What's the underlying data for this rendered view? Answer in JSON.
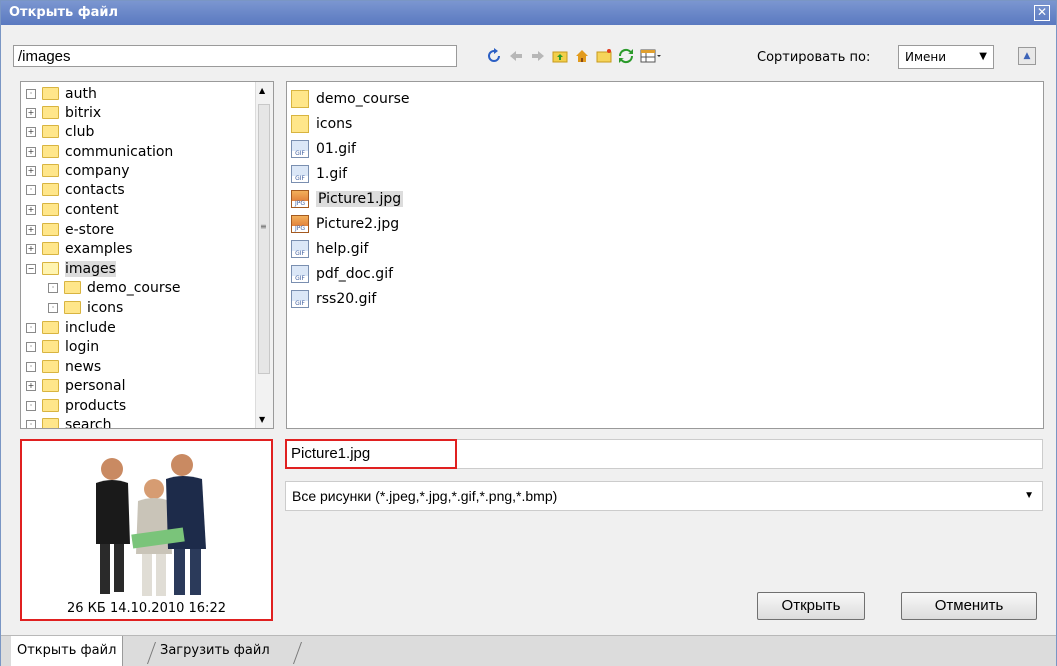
{
  "window": {
    "title": "Открыть файл"
  },
  "path": {
    "value": "/images"
  },
  "sort": {
    "label": "Сортировать по:",
    "value": "Имени"
  },
  "tree": {
    "items": [
      {
        "label": "auth",
        "exp": "·"
      },
      {
        "label": "bitrix",
        "exp": "+"
      },
      {
        "label": "club",
        "exp": "+"
      },
      {
        "label": "communication",
        "exp": "+"
      },
      {
        "label": "company",
        "exp": "+"
      },
      {
        "label": "contacts",
        "exp": "·"
      },
      {
        "label": "content",
        "exp": "+"
      },
      {
        "label": "e-store",
        "exp": "+"
      },
      {
        "label": "examples",
        "exp": "+"
      },
      {
        "label": "images",
        "exp": "−"
      },
      {
        "label": "demo_course",
        "exp": "·"
      },
      {
        "label": "icons",
        "exp": "·"
      },
      {
        "label": "include",
        "exp": "·"
      },
      {
        "label": "login",
        "exp": "·"
      },
      {
        "label": "news",
        "exp": "·"
      },
      {
        "label": "personal",
        "exp": "+"
      },
      {
        "label": "products",
        "exp": "·"
      },
      {
        "label": "search",
        "exp": "·"
      }
    ]
  },
  "files": [
    {
      "name": "demo_course"
    },
    {
      "name": "icons"
    },
    {
      "name": "01.gif"
    },
    {
      "name": "1.gif"
    },
    {
      "name": "Picture1.jpg"
    },
    {
      "name": "Picture2.jpg"
    },
    {
      "name": "help.gif"
    },
    {
      "name": "pdf_doc.gif"
    },
    {
      "name": "rss20.gif"
    }
  ],
  "icons": {
    "gif": "GIF",
    "jpg": "JPG"
  },
  "preview": {
    "meta": "26 КБ 14.10.2010 16:22"
  },
  "filename": {
    "value": "Picture1.jpg"
  },
  "filetype": {
    "value": "Все рисунки (*.jpeg,*.jpg,*.gif,*.png,*.bmp)"
  },
  "buttons": {
    "open": "Открыть",
    "cancel": "Отменить"
  },
  "tabs": {
    "open": "Открыть файл",
    "upload": "Загрузить файл"
  }
}
